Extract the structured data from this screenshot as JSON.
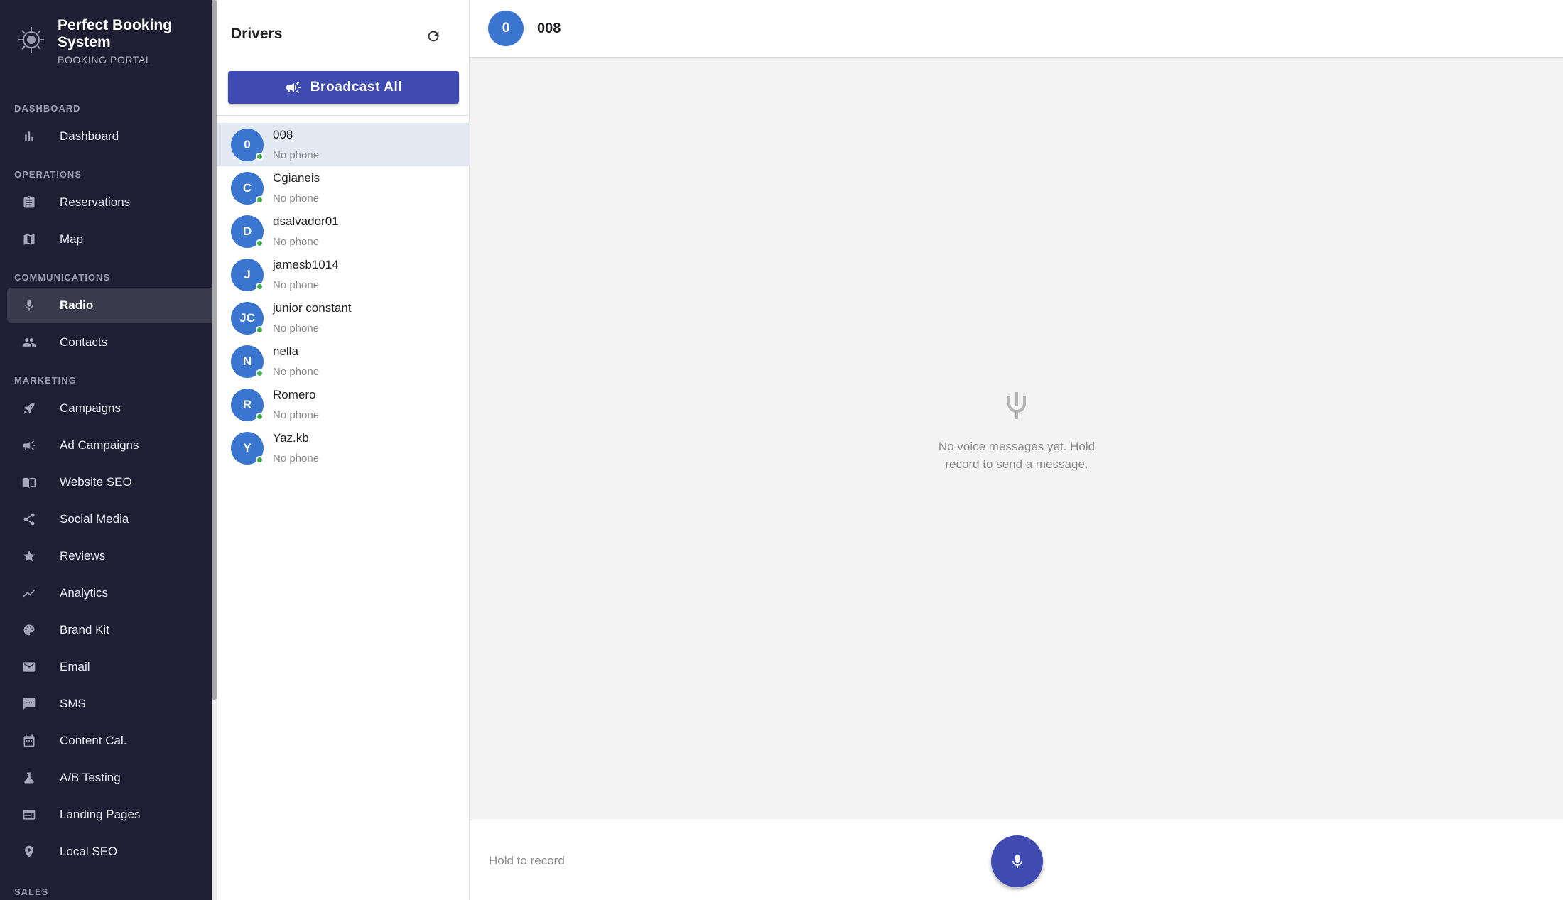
{
  "app": {
    "brand_name": "Perfect Booking System",
    "brand_sub": "BOOKING PORTAL"
  },
  "sidebar": {
    "sections": {
      "dashboard": "DASHBOARD",
      "operations": "OPERATIONS",
      "communications": "COMMUNICATIONS",
      "marketing": "MARKETING",
      "sales": "SALES"
    },
    "items": [
      {
        "label": "Dashboard",
        "icon": "bar-chart-icon"
      },
      {
        "label": "Reservations",
        "icon": "clipboard-icon"
      },
      {
        "label": "Map",
        "icon": "map-icon"
      },
      {
        "label": "Radio",
        "icon": "mic-icon",
        "active": true
      },
      {
        "label": "Contacts",
        "icon": "people-icon"
      },
      {
        "label": "Campaigns",
        "icon": "rocket-icon"
      },
      {
        "label": "Ad Campaigns",
        "icon": "megaphone-icon"
      },
      {
        "label": "Website SEO",
        "icon": "book-icon"
      },
      {
        "label": "Social Media",
        "icon": "share-icon"
      },
      {
        "label": "Reviews",
        "icon": "star-icon"
      },
      {
        "label": "Analytics",
        "icon": "trend-icon"
      },
      {
        "label": "Brand Kit",
        "icon": "palette-icon"
      },
      {
        "label": "Email",
        "icon": "mail-icon"
      },
      {
        "label": "SMS",
        "icon": "chat-bubble-icon"
      },
      {
        "label": "Content Cal.",
        "icon": "calendar-icon"
      },
      {
        "label": "A/B Testing",
        "icon": "flask-icon"
      },
      {
        "label": "Landing Pages",
        "icon": "web-page-icon"
      },
      {
        "label": "Local SEO",
        "icon": "pin-icon"
      }
    ]
  },
  "drivers_panel": {
    "title": "Drivers",
    "broadcast_label": "Broadcast All",
    "drivers": [
      {
        "initials": "0",
        "name": "008",
        "phone": "No phone",
        "selected": true
      },
      {
        "initials": "C",
        "name": "Cgianeis",
        "phone": "No phone"
      },
      {
        "initials": "D",
        "name": "dsalvador01",
        "phone": "No phone"
      },
      {
        "initials": "J",
        "name": "jamesb1014",
        "phone": "No phone"
      },
      {
        "initials": "JC",
        "name": "junior constant",
        "phone": "No phone"
      },
      {
        "initials": "N",
        "name": "nella",
        "phone": "No phone"
      },
      {
        "initials": "R",
        "name": "Romero",
        "phone": "No phone"
      },
      {
        "initials": "Y",
        "name": "Yaz.kb",
        "phone": "No phone"
      }
    ]
  },
  "chat": {
    "header_initial": "0",
    "header_name": "008",
    "empty_message": "No voice messages yet. Hold record to send a message.",
    "record_hint": "Hold to record"
  },
  "colors": {
    "sidebar_bg": "#1f1f33",
    "accent": "#3f4bb0",
    "avatar": "#3a75cf",
    "online": "#3fae49"
  }
}
